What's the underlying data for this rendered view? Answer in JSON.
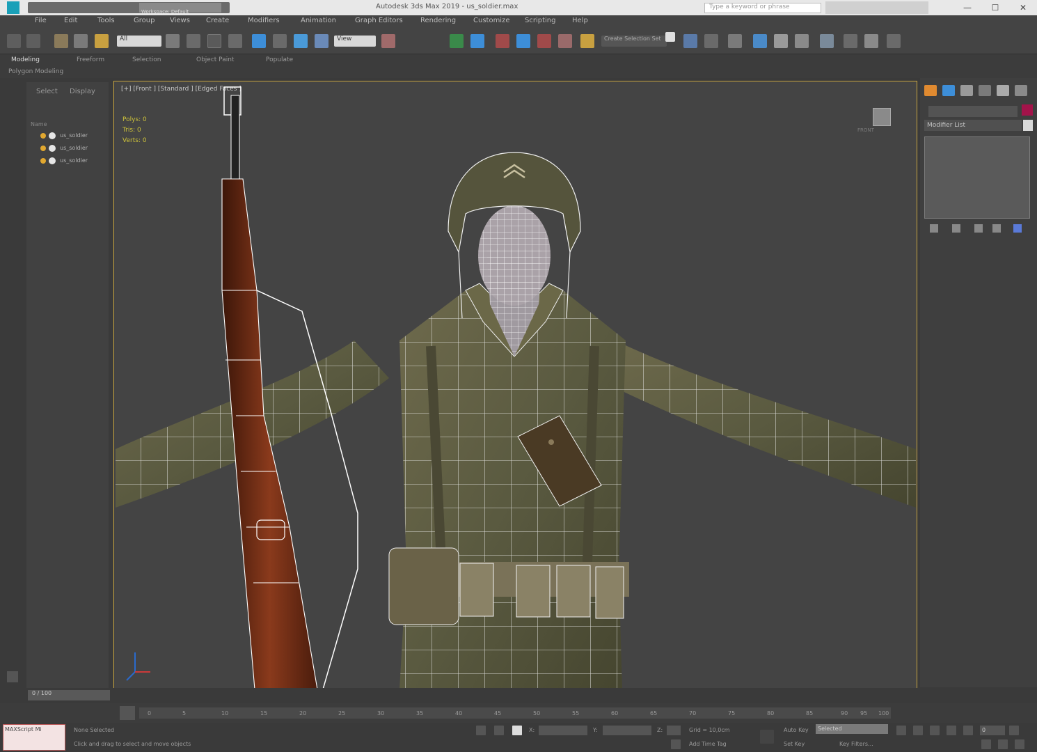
{
  "title_bar": {
    "workspace": "Workspace: Default",
    "title": "Autodesk 3ds Max 2019 - us_soldier.max",
    "search_placeholder": "Type a keyword or phrase",
    "minimize": "—",
    "maximize": "☐",
    "close": "✕"
  },
  "menu": [
    "File",
    "Edit",
    "Tools",
    "Group",
    "Views",
    "Create",
    "Modifiers",
    "Animation",
    "Graph Editors",
    "Rendering",
    "Customize",
    "Scripting",
    "Help"
  ],
  "toolbar": {
    "selection_filter": "All",
    "coordinate_system": "View",
    "named_selection": "Create Selection Set"
  },
  "ribbon": {
    "tabs": [
      "Modeling",
      "Freeform",
      "Selection",
      "Object Paint",
      "Populate"
    ],
    "panel": "Polygon Modeling"
  },
  "scene_explorer": {
    "tabs": [
      "Select",
      "Display"
    ],
    "header": "Name",
    "objects": [
      "us_soldier",
      "us_soldier",
      "us_soldier"
    ]
  },
  "viewport": {
    "label": "[+] [Front ] [Standard ] [Edged Faces ]",
    "stats": [
      {
        "label": "Polys:",
        "value": "0"
      },
      {
        "label": "Tris:",
        "value": "0"
      },
      {
        "label": "Verts:",
        "value": "0"
      }
    ],
    "viewcube_label": "FRONT"
  },
  "command_panel": {
    "object_name": "",
    "modifier_list": "Modifier List",
    "color": "#a3134a"
  },
  "time_slider": {
    "value": "0 / 100"
  },
  "timeline_ticks": [
    "0",
    "5",
    "10",
    "15",
    "20",
    "25",
    "30",
    "35",
    "40",
    "45",
    "50",
    "55",
    "60",
    "65",
    "70",
    "75",
    "80",
    "85",
    "90",
    "95",
    "100"
  ],
  "status": {
    "maxscript": "MAXScript Mi",
    "message_1": "None Selected",
    "message_2": "Click and drag to select and move objects",
    "x_label": "X:",
    "y_label": "Y:",
    "z_label": "Z:",
    "grid": "Grid = 10,0cm",
    "add_time_tag": "Add Time Tag",
    "auto_key": "Auto Key",
    "set_key": "Set Key",
    "selected": "Selected",
    "key_filters": "Key Filters...",
    "frame": "0"
  }
}
